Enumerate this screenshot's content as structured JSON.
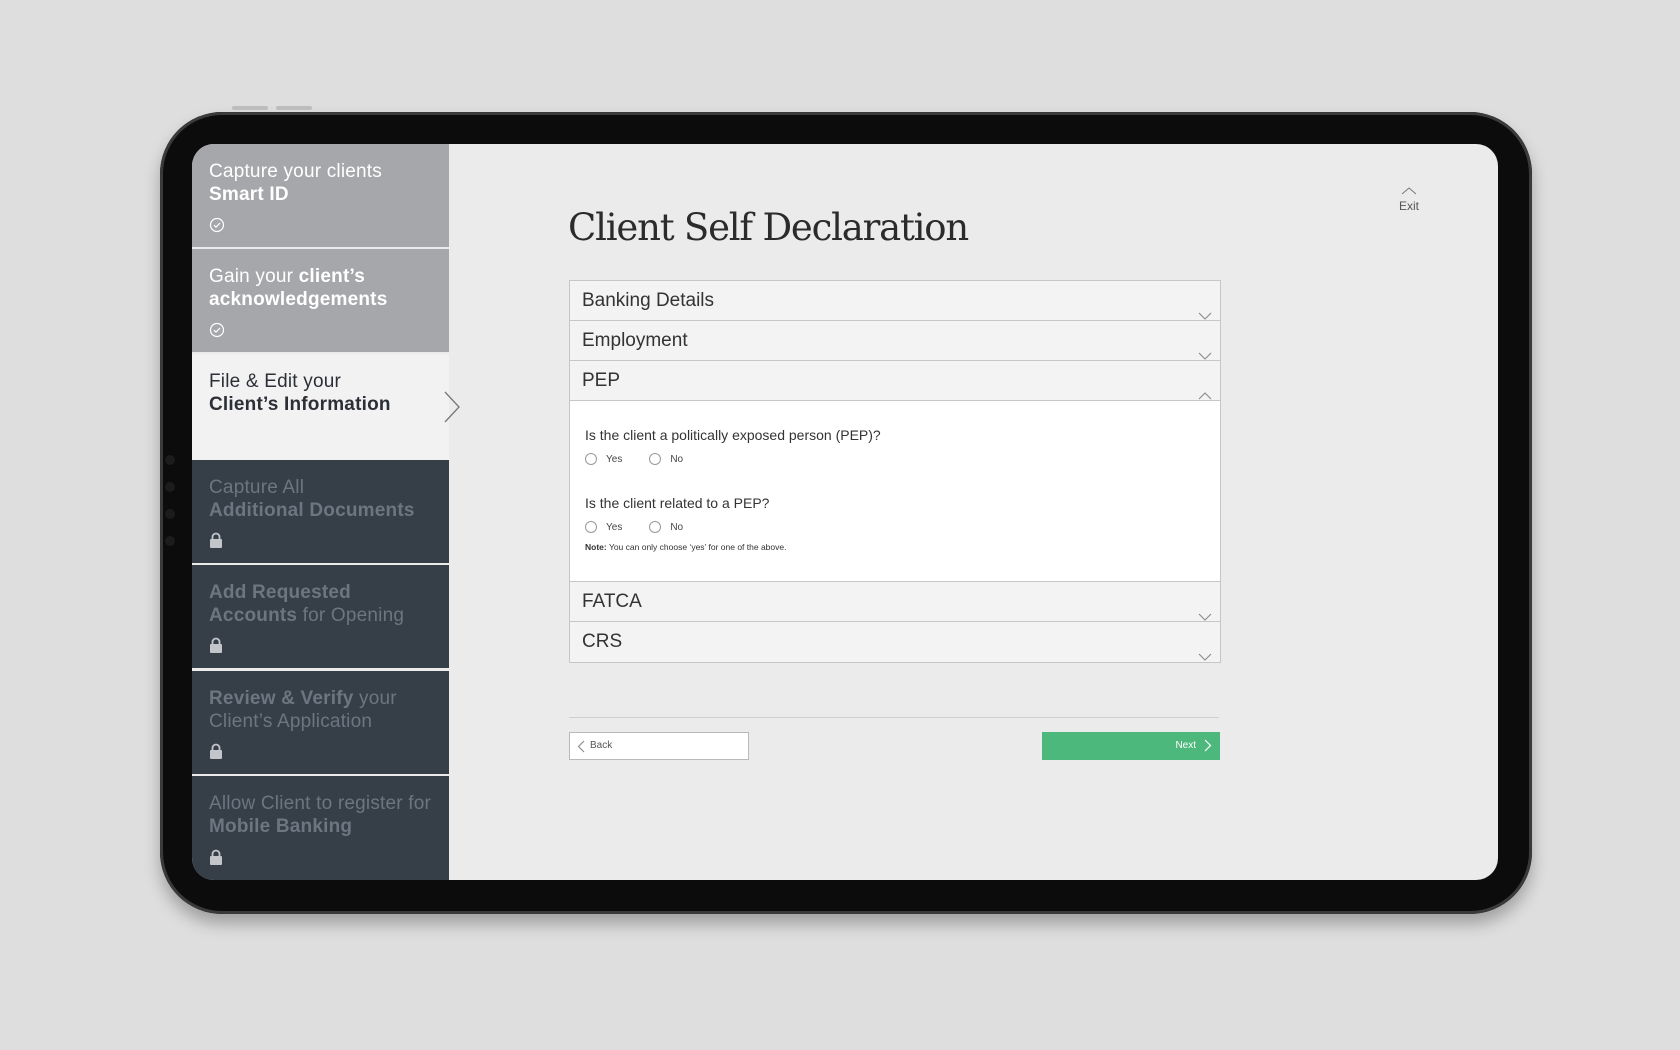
{
  "steps": [
    {
      "pre": "Capture your clients",
      "bold": "Smart ID",
      "post": "",
      "status": "completed",
      "status_icon": "check-circle-icon"
    },
    {
      "pre": "Gain your ",
      "bold": "client’s acknowledgements",
      "post": "",
      "status": "completed",
      "status_icon": "check-circle-icon"
    },
    {
      "pre": "File & Edit your",
      "bold": "Client’s Information",
      "post": "",
      "status": "current",
      "status_icon": "chevron-right-icon"
    },
    {
      "pre": "Capture All",
      "bold": "Additional Documents",
      "post": "",
      "status": "locked",
      "status_icon": "lock-icon"
    },
    {
      "pre": "",
      "bold": "Add Requested Accounts",
      "post": " for Opening",
      "status": "locked",
      "status_icon": "lock-icon"
    },
    {
      "pre": "",
      "bold": "Review & Verify",
      "post": " your Client’s Application",
      "status": "locked",
      "status_icon": "lock-icon"
    },
    {
      "pre": "Allow Client to register for ",
      "bold": "Mobile Banking",
      "post": "",
      "status": "locked",
      "status_icon": "lock-icon"
    }
  ],
  "header": {
    "title": "Client Self Declaration",
    "exit_label": "Exit"
  },
  "accordion": {
    "sections": [
      "Banking Details",
      "Employment",
      "PEP",
      "FATCA",
      "CRS"
    ],
    "expanded": "PEP",
    "pep": {
      "q1": "Is the client a politically exposed person (PEP)?",
      "q2": "Is the client related to a PEP?",
      "yes": "Yes",
      "no": "No",
      "note_label": "Note:",
      "note_text": " You can only choose ‘yes’ for one of the above."
    }
  },
  "footer": {
    "back_label": "Back",
    "next_label": "Next"
  },
  "colors": {
    "next_button": "#4cb87c",
    "locked_step": "#363f48",
    "completed_step": "#a6a7aa"
  }
}
